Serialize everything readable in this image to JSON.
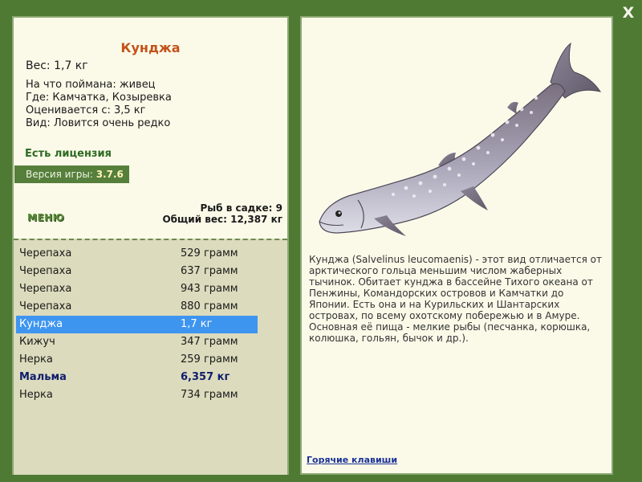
{
  "window": {
    "close_label": "X"
  },
  "fish": {
    "title": "Кунджа",
    "weight": "Вес: 1,7 кг",
    "bait": "На что поймана: живец",
    "location": "Где: Камчатка, Козыревка",
    "valued_from": "Оценивается с: 3,5 кг",
    "rarity": "Вид: Ловится очень редко"
  },
  "license": "Есть лицензия",
  "version": {
    "label": "Версия игры:",
    "value": "3.7.6"
  },
  "menu_label": "МЕНЮ",
  "cage": {
    "count": "Рыб в садке: 9",
    "total_weight": "Общий вес: 12,387 кг"
  },
  "catch_list": [
    {
      "name": "Черепаха",
      "weight": "529 грамм"
    },
    {
      "name": "Черепаха",
      "weight": "637 грамм"
    },
    {
      "name": "Черепаха",
      "weight": "943 грамм"
    },
    {
      "name": "Черепаха",
      "weight": "880 грамм"
    },
    {
      "name": "Кунджа",
      "weight": "1,7 кг"
    },
    {
      "name": "Кижуч",
      "weight": "347 грамм"
    },
    {
      "name": "Нерка",
      "weight": "259 грамм"
    },
    {
      "name": "Мальма",
      "weight": "6,357 кг"
    },
    {
      "name": "Нерка",
      "weight": "734 грамм"
    }
  ],
  "description": "Кунджа (Salvelinus leucomaenis) - этот вид отличается от арктического гольца меньшим числом жаберных тычинок. Обитает кунджа в бассейне Тихого океана от Пенжины, Командорских островов и Камчатки до Японии. Есть она и на Курильских и Шантарских островах, по всему охотскому побережью и в Амуре. Основная её пища - мелкие рыбы (песчанка, корюшка, колюшка, гольян, бычок и др.).",
  "hotkeys_link": "Горячие клавиши",
  "colors": {
    "background": "#4e7a34",
    "panel": "#fbfae9",
    "title": "#c3531a",
    "selected_row": "#3e95f0",
    "highlight_row": "#0f1d6d"
  }
}
